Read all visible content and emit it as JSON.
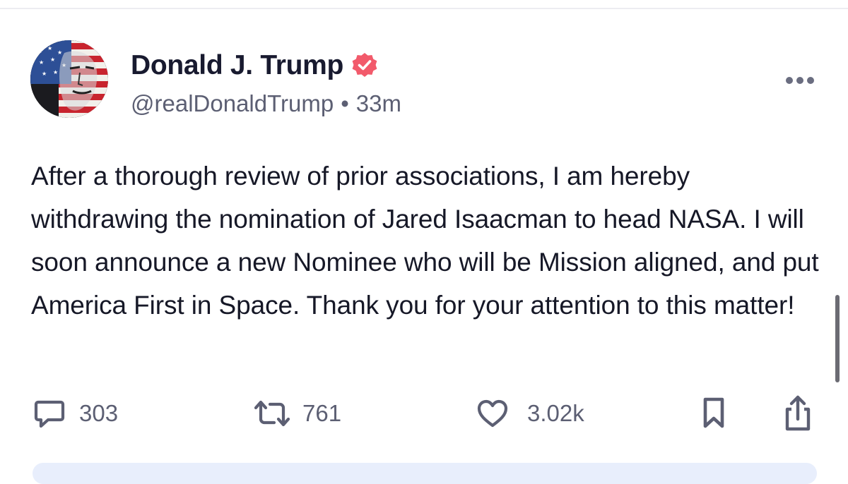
{
  "post": {
    "author": {
      "display_name": "Donald J. Trump",
      "handle": "@realDonaldTrump",
      "separator": "•",
      "time_ago": "33m",
      "verified": true
    },
    "body": "After a thorough review of prior associations, I am hereby withdrawing the nomination of Jared Isaacman to head NASA. I will soon announce a new Nominee who will be Mission aligned, and put America First in Space. Thank you for your attention to this matter!",
    "stats": {
      "replies": "303",
      "reposts": "761",
      "likes": "3.02k"
    }
  },
  "colors": {
    "verified_badge": "#f25a6b",
    "text_primary": "#181a2f",
    "text_secondary": "#5c5f73",
    "icon_gray": "#5c5f73"
  },
  "icons": {
    "verified": "verified-badge-icon",
    "more": "more-dots-icon",
    "reply": "comment-icon",
    "repost": "repost-icon",
    "like": "heart-icon",
    "bookmark": "bookmark-icon",
    "share": "share-icon"
  }
}
